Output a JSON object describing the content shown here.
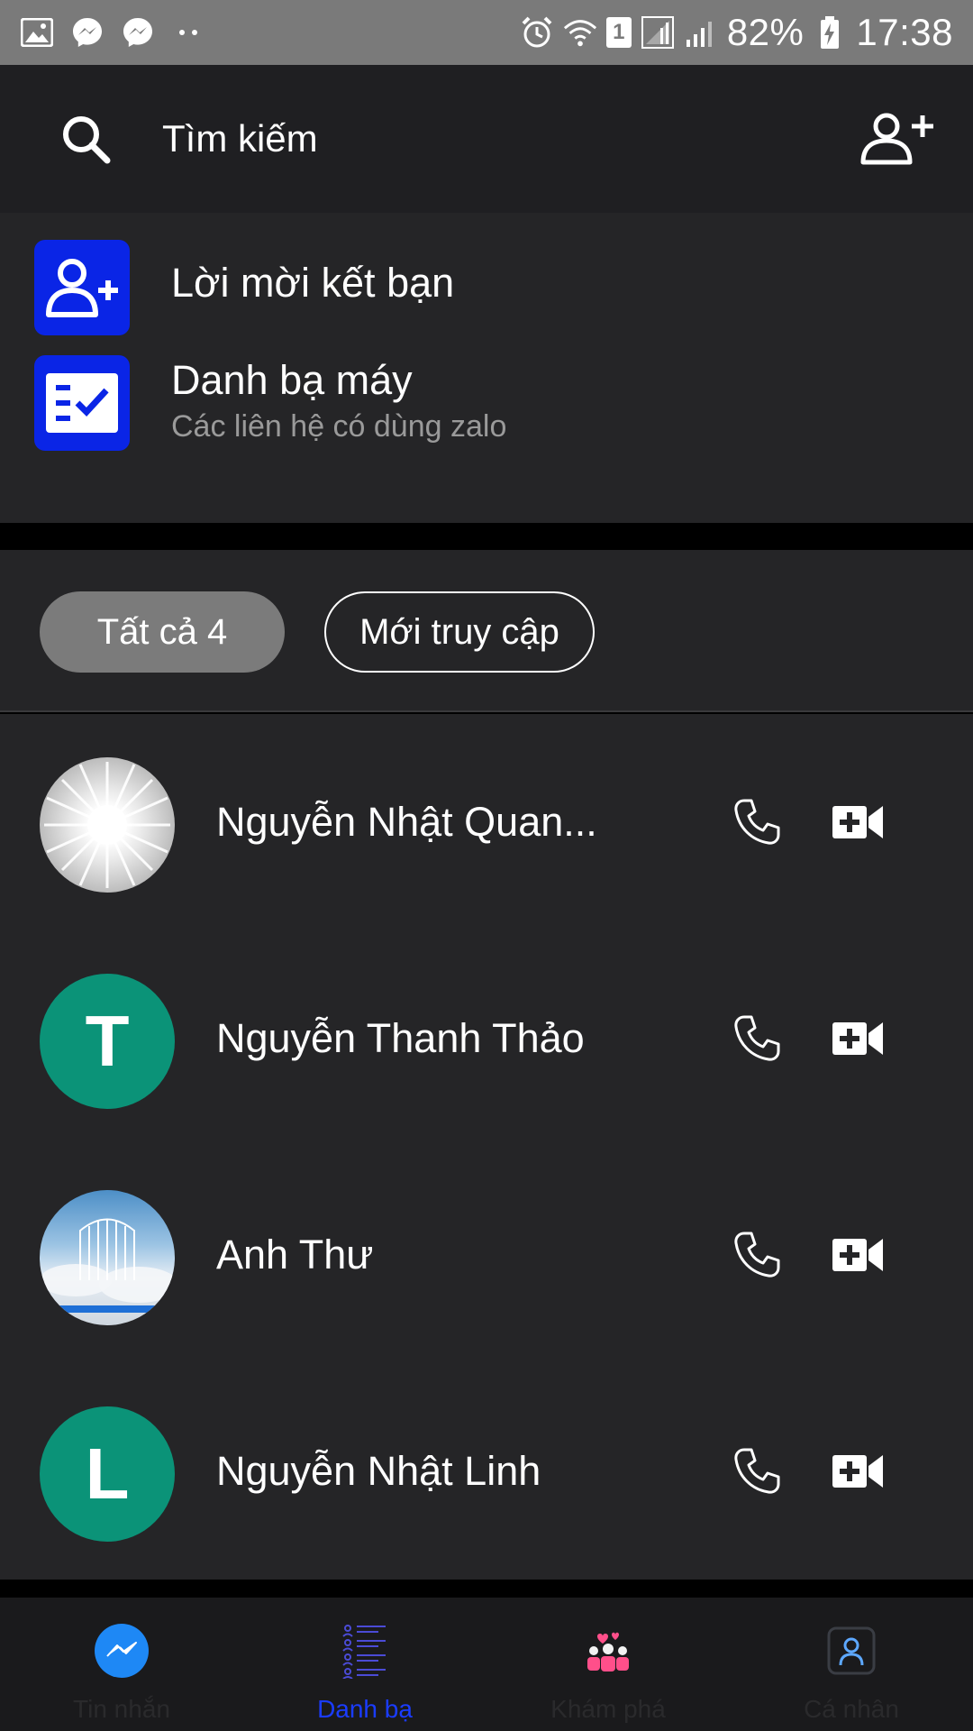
{
  "status_bar": {
    "battery": "82%",
    "time": "17:38",
    "sim": "1",
    "left_icons": [
      "image-icon",
      "messenger-icon",
      "messenger-icon",
      "more-dots-icon"
    ],
    "right_icons": [
      "alarm-icon",
      "wifi-icon",
      "sim-icon",
      "signal-icon",
      "signal-icon",
      "battery-charging-icon"
    ]
  },
  "header": {
    "search_label": "Tìm kiếm",
    "icons": [
      "search-icon",
      "add-friend-icon"
    ]
  },
  "menu": {
    "friend_requests": {
      "title": "Lời mời kết bạn",
      "icon": "add-friend-icon"
    },
    "phone_contacts": {
      "title": "Danh bạ máy",
      "subtitle": "Các liên hệ có dùng zalo",
      "icon": "contact-list-check-icon"
    },
    "icon_color": "#0a25e6"
  },
  "filters": {
    "all": "Tất cả 4",
    "recent": "Mới truy cập"
  },
  "contacts": [
    {
      "name": "Nguyễn Nhật Quan...",
      "avatar_letter": "",
      "avatar": "sunburst-photo"
    },
    {
      "name": "Nguyễn Thanh Thảo",
      "avatar_letter": "T",
      "avatar": "letter"
    },
    {
      "name": "Anh Thư",
      "avatar_letter": "",
      "avatar": "gate-photo"
    },
    {
      "name": "Nguyễn Nhật Linh",
      "avatar_letter": "L",
      "avatar": "letter"
    }
  ],
  "colors": {
    "avatar_green": "#0b9378",
    "background": "#252527",
    "header": "#1f1f22",
    "nav_active": "#1a3cff"
  },
  "bottom_nav": [
    {
      "label": "Tin nhắn",
      "icon": "messenger-icon",
      "active": false
    },
    {
      "label": "Danh bạ",
      "icon": "contacts-icon",
      "active": true
    },
    {
      "label": "Khám phá",
      "icon": "discover-icon",
      "active": false
    },
    {
      "label": "Cá nhân",
      "icon": "profile-icon",
      "active": false
    }
  ]
}
